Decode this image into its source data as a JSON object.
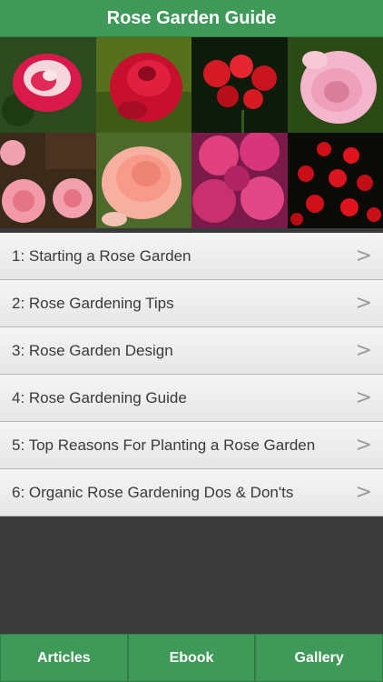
{
  "header": {
    "title": "Rose Garden Guide"
  },
  "gallery": {
    "tiles": [
      {
        "name": "rose-photo-bicolor"
      },
      {
        "name": "rose-photo-red-dew"
      },
      {
        "name": "rose-photo-red-cluster"
      },
      {
        "name": "rose-photo-pink-light"
      },
      {
        "name": "rose-photo-pink-bush"
      },
      {
        "name": "rose-photo-peach"
      },
      {
        "name": "rose-photo-magenta"
      },
      {
        "name": "rose-photo-red-shrub"
      }
    ]
  },
  "articles": [
    {
      "label": "1: Starting a Rose Garden"
    },
    {
      "label": "2: Rose Gardening Tips"
    },
    {
      "label": "3: Rose Garden Design"
    },
    {
      "label": "4: Rose Gardening Guide"
    },
    {
      "label": "5: Top Reasons For Planting a Rose Garden"
    },
    {
      "label": "6: Organic Rose Gardening Dos & Don'ts"
    }
  ],
  "chevron": ">",
  "tabs": [
    {
      "label": "Articles"
    },
    {
      "label": "Ebook"
    },
    {
      "label": "Gallery"
    }
  ],
  "colors": {
    "accent": "#3f9a5a",
    "background": "#3a3a3a"
  }
}
